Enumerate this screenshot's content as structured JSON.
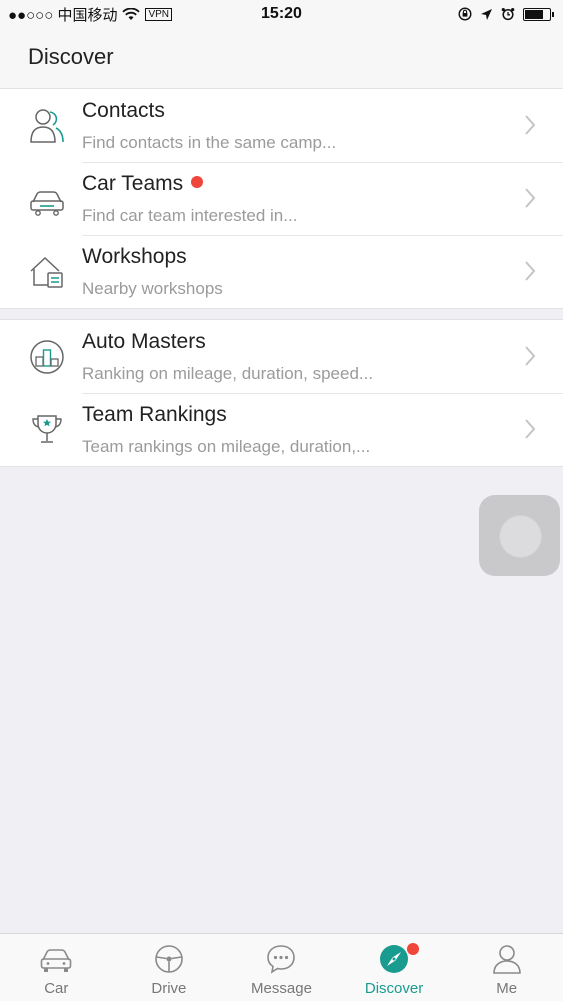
{
  "status_bar": {
    "carrier": "●●○○○ 中国移动",
    "vpn": "VPN",
    "time": "15:20"
  },
  "header": {
    "title": "Discover"
  },
  "discover_groups": [
    {
      "items": [
        {
          "title": "Contacts",
          "subtitle": "Find contacts in the same camp...",
          "icon": "contacts-icon",
          "badge": false
        },
        {
          "title": "Car Teams",
          "subtitle": "Find car team interested in...",
          "icon": "car-icon",
          "badge": true
        },
        {
          "title": "Workshops",
          "subtitle": "Nearby workshops",
          "icon": "workshop-icon",
          "badge": false
        }
      ]
    },
    {
      "items": [
        {
          "title": "Auto Masters",
          "subtitle": "Ranking on mileage, duration, speed...",
          "icon": "podium-icon",
          "badge": false
        },
        {
          "title": "Team Rankings",
          "subtitle": "Team rankings on mileage, duration,...",
          "icon": "trophy-icon",
          "badge": false
        }
      ]
    }
  ],
  "tab_bar": {
    "tabs": [
      {
        "label": "Car",
        "icon": "car-icon",
        "active": false
      },
      {
        "label": "Drive",
        "icon": "steering-wheel-icon",
        "active": false
      },
      {
        "label": "Message",
        "icon": "chat-bubble-icon",
        "active": false
      },
      {
        "label": "Discover",
        "icon": "compass-icon",
        "active": true,
        "badge": true
      },
      {
        "label": "Me",
        "icon": "person-icon",
        "active": false
      }
    ]
  },
  "colors": {
    "accent": "#1a9b8f",
    "badge": "#f0453a",
    "background": "#efeff4"
  }
}
